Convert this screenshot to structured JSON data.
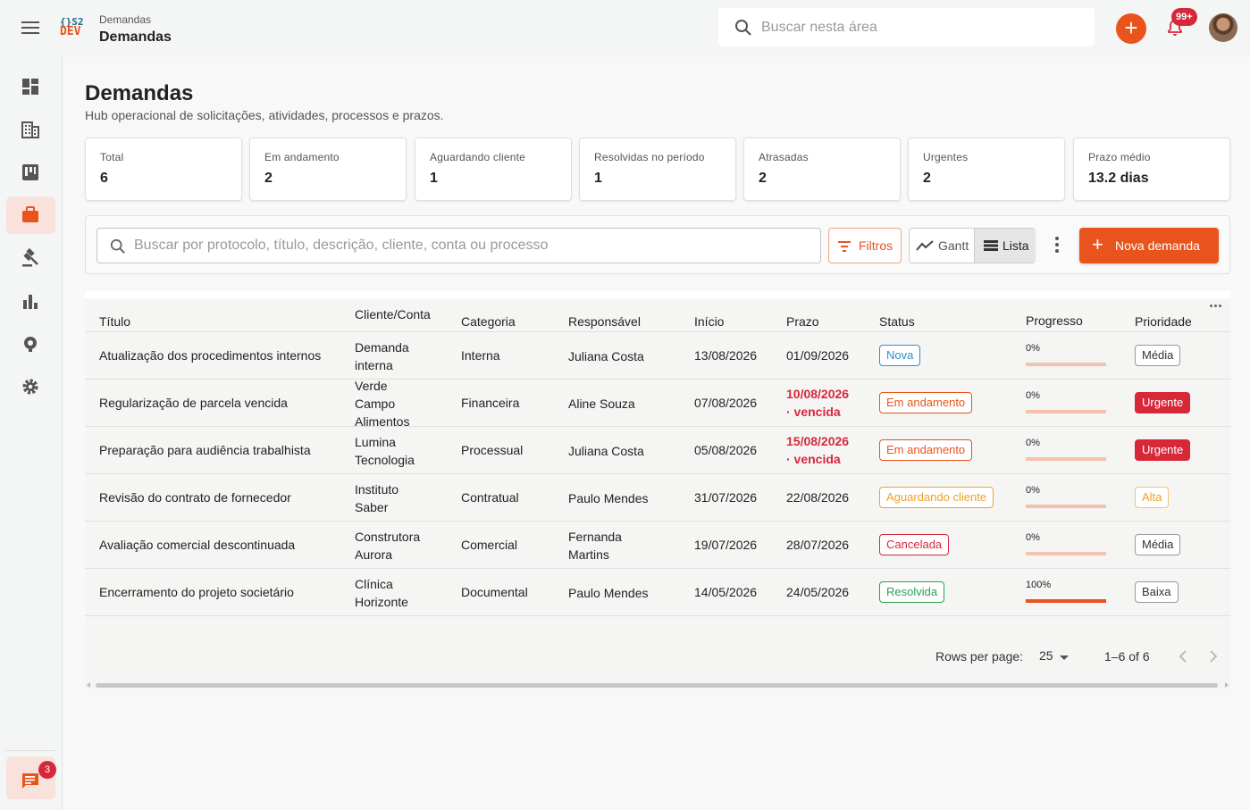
{
  "topbar": {
    "breadcrumb": "Demandas",
    "title": "Demandas",
    "search_placeholder": "Buscar nesta área",
    "notification_count": "99+",
    "logo_line1": "{}S2",
    "logo_line2": "DEV"
  },
  "sidebar": {
    "items": [
      {
        "icon": "dashboard-icon"
      },
      {
        "icon": "building-icon"
      },
      {
        "icon": "kanban-icon"
      },
      {
        "icon": "briefcase-icon",
        "active": true
      },
      {
        "icon": "gavel-icon"
      },
      {
        "icon": "bar-chart-icon"
      },
      {
        "icon": "support-icon"
      },
      {
        "icon": "gear-icon"
      }
    ],
    "chat_badge": "3"
  },
  "page": {
    "title": "Demandas",
    "subtitle": "Hub operacional de solicitações, atividades, processos e prazos."
  },
  "stats": [
    {
      "label": "Total",
      "value": "6"
    },
    {
      "label": "Em andamento",
      "value": "2"
    },
    {
      "label": "Aguardando cliente",
      "value": "1"
    },
    {
      "label": "Resolvidas no período",
      "value": "1"
    },
    {
      "label": "Atrasadas",
      "value": "2"
    },
    {
      "label": "Urgentes",
      "value": "2"
    },
    {
      "label": "Prazo médio",
      "value": "13.2 dias"
    }
  ],
  "toolbar": {
    "search_placeholder": "Buscar por protocolo, título, descrição, cliente, conta ou processo",
    "filters_label": "Filtros",
    "gantt_label": "Gantt",
    "list_label": "Lista",
    "new_label": "Nova demanda"
  },
  "table": {
    "columns": [
      "Título",
      "Cliente/Conta",
      "Categoria",
      "Responsável",
      "Início",
      "Prazo",
      "Status",
      "Progresso",
      "Prioridade"
    ],
    "rows": [
      {
        "titulo": "Atualização dos procedimentos internos",
        "cliente": [
          "Demanda",
          "interna"
        ],
        "categoria": "Interna",
        "responsavel": [
          "Juliana Costa"
        ],
        "inicio": "13/08/2026",
        "prazo": "01/09/2026",
        "prazo_note": "",
        "status": "Nova",
        "progresso": 0,
        "progresso_label": "0%",
        "prioridade": "Média"
      },
      {
        "titulo": "Regularização de parcela vencida",
        "cliente": [
          "Verde",
          "Campo",
          "Alimentos"
        ],
        "categoria": "Financeira",
        "responsavel": [
          "Aline Souza"
        ],
        "inicio": "07/08/2026",
        "prazo": "10/08/2026",
        "prazo_note": "· vencida",
        "status": "Em andamento",
        "progresso": 0,
        "progresso_label": "0%",
        "prioridade": "Urgente"
      },
      {
        "titulo": "Preparação para audiência trabalhista",
        "cliente": [
          "Lumina",
          "Tecnologia"
        ],
        "categoria": "Processual",
        "responsavel": [
          "Juliana Costa"
        ],
        "inicio": "05/08/2026",
        "prazo": "15/08/2026",
        "prazo_note": "· vencida",
        "status": "Em andamento",
        "progresso": 0,
        "progresso_label": "0%",
        "prioridade": "Urgente"
      },
      {
        "titulo": "Revisão do contrato de fornecedor",
        "cliente": [
          "Instituto",
          "Saber"
        ],
        "categoria": "Contratual",
        "responsavel": [
          "Paulo Mendes"
        ],
        "inicio": "31/07/2026",
        "prazo": "22/08/2026",
        "prazo_note": "",
        "status": "Aguardando cliente",
        "progresso": 0,
        "progresso_label": "0%",
        "prioridade": "Alta"
      },
      {
        "titulo": "Avaliação comercial descontinuada",
        "cliente": [
          "Construtora",
          "Aurora"
        ],
        "categoria": "Comercial",
        "responsavel": [
          "Fernanda",
          "Martins"
        ],
        "inicio": "19/07/2026",
        "prazo": "28/07/2026",
        "prazo_note": "",
        "status": "Cancelada",
        "progresso": 0,
        "progresso_label": "0%",
        "prioridade": "Média"
      },
      {
        "titulo": "Encerramento do projeto societário",
        "cliente": [
          "Clínica",
          "Horizonte"
        ],
        "categoria": "Documental",
        "responsavel": [
          "Paulo Mendes"
        ],
        "inicio": "14/05/2026",
        "prazo": "24/05/2026",
        "prazo_note": "",
        "status": "Resolvida",
        "progresso": 1.0,
        "progresso_label": "100%",
        "prioridade": "Baixa"
      }
    ]
  },
  "status_colors": {
    "Nova": "#2f8fce",
    "Em andamento": "#e8541c",
    "Aguardando cliente": "#f0a02b",
    "Cancelada": "#d7283a",
    "Resolvida": "#2e9e4f"
  },
  "priority_styles": {
    "Média": {
      "color": "#333333",
      "border": "#999999",
      "bg": "#ffffff"
    },
    "Urgente": {
      "color": "#ffffff",
      "border": "#d7283a",
      "bg": "#d7283a"
    },
    "Alta": {
      "color": "#f0a02b",
      "border": "#f0c27c",
      "bg": "#ffffff"
    },
    "Baixa": {
      "color": "#333333",
      "border": "#999999",
      "bg": "#ffffff"
    }
  },
  "pagination": {
    "rows_per_page_label": "Rows per page:",
    "rows_per_page": "25",
    "range": "1–6 of 6"
  },
  "colors": {
    "accent": "#e8541c",
    "danger": "#d7283a"
  }
}
